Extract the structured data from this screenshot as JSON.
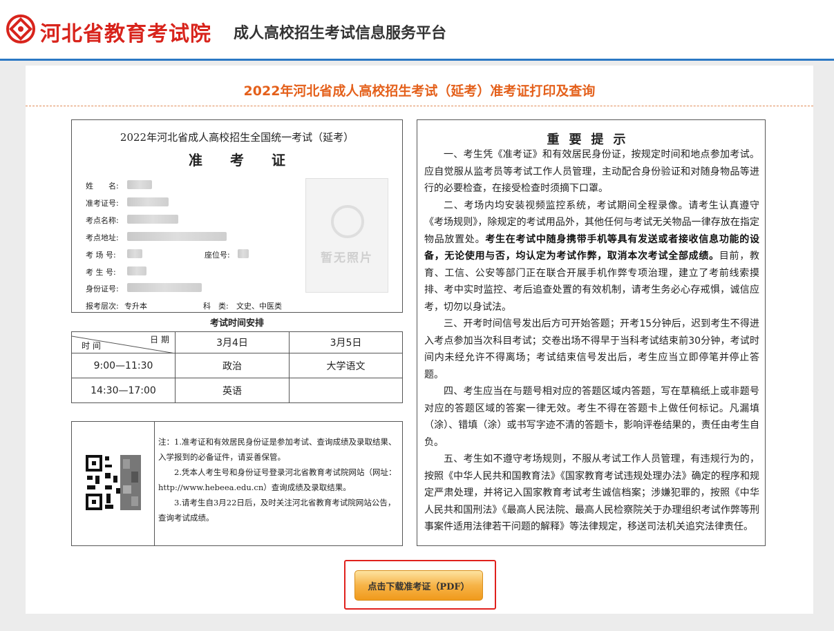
{
  "header": {
    "site_name": "河北省教育考试院",
    "platform_name": "成人高校招生考试信息服务平台",
    "brand_color": "#d8241c",
    "accent_color": "#2b78c4",
    "logo_icon": "hebei-exam-logo-icon"
  },
  "page_title": "2022年河北省成人高校招生考试（延考）准考证打印及查询",
  "ticket": {
    "title": "2022年河北省成人高校招生全国统一考试（延考）",
    "subtitle": "准考证",
    "labels": {
      "name": "姓　　名:",
      "ticket_no": "准考证号:",
      "site_name": "考点名称:",
      "site_addr": "考点地址:",
      "room": "考 场 号:",
      "seat": "座位号:",
      "student_no": "考 生 号:",
      "id_no": "身份证号:",
      "level": "报考层次:",
      "category": "科　类:"
    },
    "level_value": "专升本",
    "category_value": "文史、中医类",
    "photo_placeholder": "暂无照片"
  },
  "schedule": {
    "caption": "考试时间安排",
    "corner_date": "日 期",
    "corner_time": "时 间",
    "dates": [
      "3月4日",
      "3月5日"
    ],
    "rows": [
      {
        "time": "9:00—11:30",
        "subjects": [
          "政治",
          "大学语文"
        ]
      },
      {
        "time": "14:30—17:00",
        "subjects": [
          "英语",
          ""
        ]
      }
    ]
  },
  "notes": {
    "lines": [
      "注：1.准考证和有效居民身份证是参加考试、查询成绩及录取结果、入学报到的必备证件，请妥善保管。",
      "　　2.凭本人考生号和身份证号登录河北省教育考试院网站（网址：http://www.hebeea.edu.cn）查询成绩及录取结果。",
      "　　3.请考生自3月22日后，及时关注河北省教育考试院网站公告，查询考试成绩。"
    ]
  },
  "tips": {
    "title": "重要提示",
    "p1": "一、考生凭《准考证》和有效居民身份证，按规定时间和地点参加考试。应自觉服从监考员等考试工作人员管理，主动配合身份验证和对随身物品等进行的必要检查，在接受检查时须摘下口罩。",
    "p2_a": "二、考场内均安装视频监控系统，考试期间全程录像。请考生认真遵守《考场规则》，除规定的考试用品外，其他任何与考试无关物品一律存放在指定物品放置处。",
    "p2_b": "考生在考试中随身携带手机等具有发送或者接收信息功能的设备，无论使用与否，均认定为考试作弊，取消本次考试全部成绩。",
    "p2_c": "目前，教育、工信、公安等部门正在联合开展手机作弊专项治理，建立了考前线索摸排、考中实时监控、考后追查处置的有效机制，请考生务必心存戒惧，诚信应考，切勿以身试法。",
    "p3": "三、开考时间信号发出后方可开始答题；开考15分钟后，迟到考生不得进入考点参加当次科目考试；交卷出场不得早于当科考试结束前30分钟，考试时间内未经允许不得离场；考试结束信号发出后，考生应当立即停笔并停止答题。",
    "p4": "四、考生应当在与题号相对应的答题区域内答题，写在草稿纸上或非题号对应的答题区域的答案一律无效。考生不得在答题卡上做任何标记。凡漏填（涂）、错填（涂）或书写字迹不清的答题卡，影响评卷结果的，责任由考生自负。",
    "p5": "五、考生如不遵守考场规则，不服从考试工作人员管理，有违规行为的，按照《中华人民共和国教育法》《国家教育考试违规处理办法》确定的程序和规定严肃处理，并将记入国家教育考试考生诚信档案；涉嫌犯罪的，按照《中华人民共和国刑法》《最高人民法院、最高人民检察院关于办理组织考试作弊等刑事案件适用法律若干问题的解释》等法律规定，移送司法机关追究法律责任。"
  },
  "download": {
    "label": "点击下载准考证（PDF）",
    "highlight_color": "#e0201c"
  }
}
